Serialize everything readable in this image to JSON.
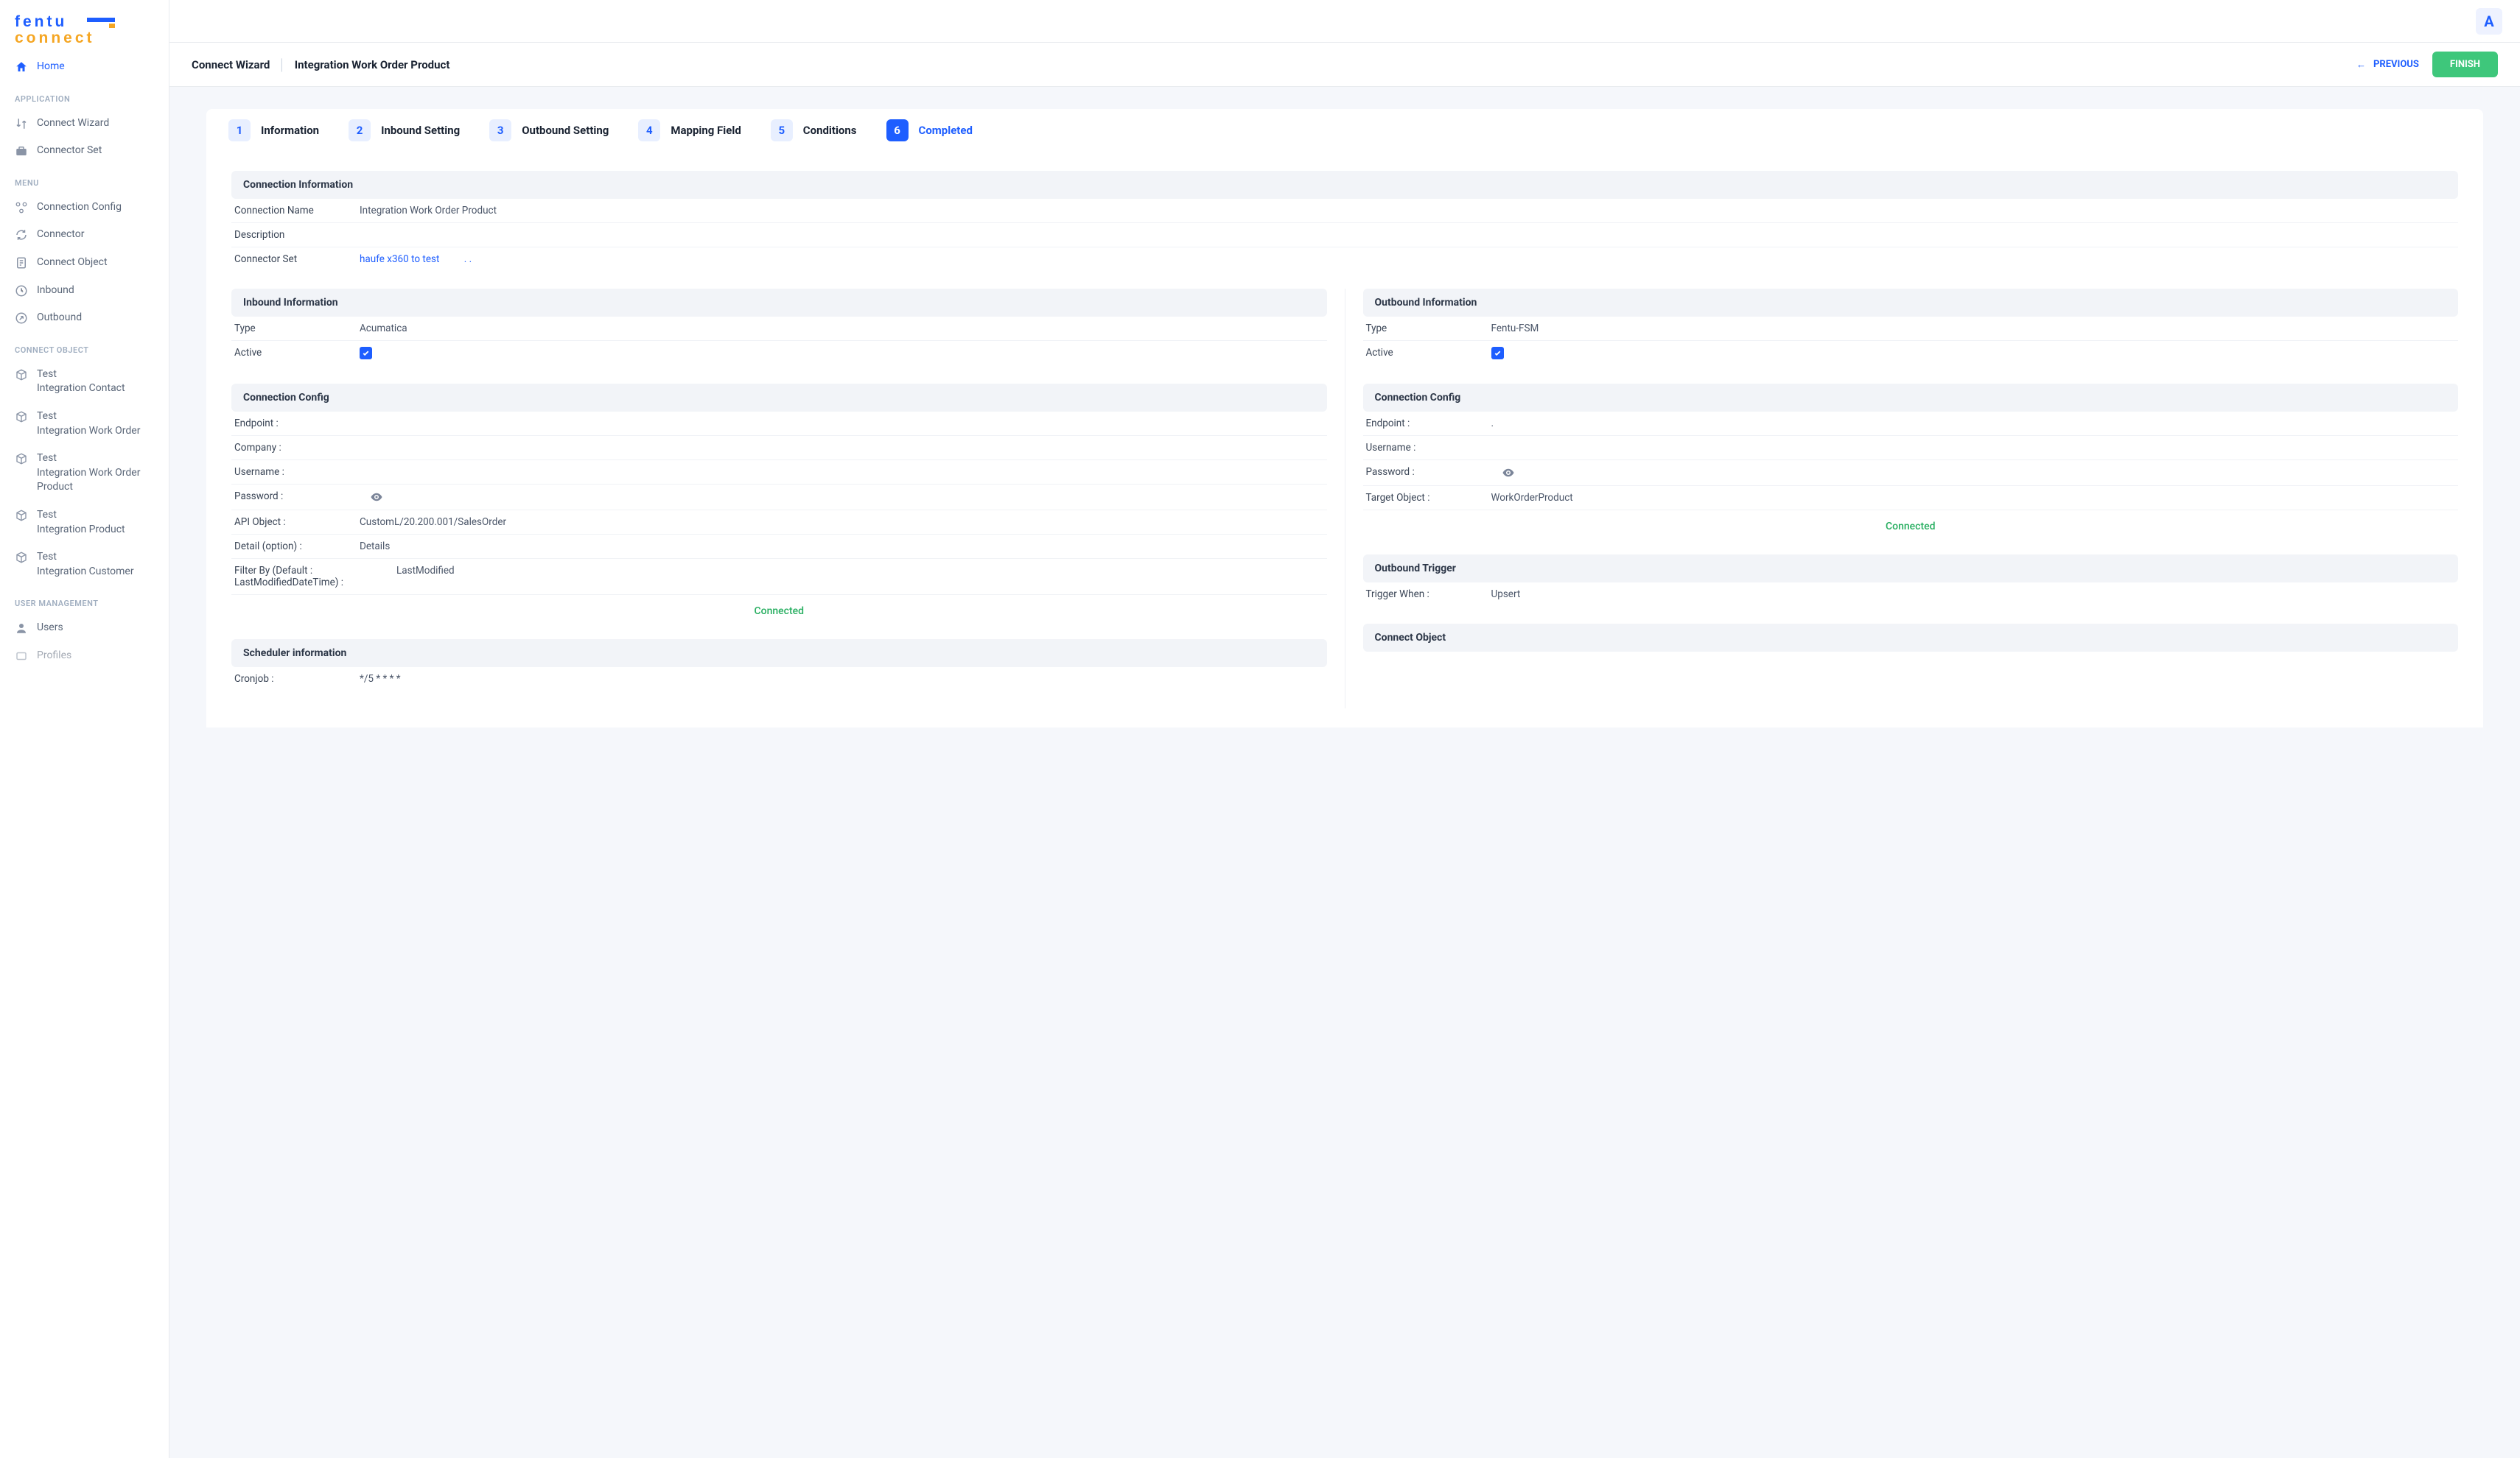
{
  "logo": {
    "line1a": "fentu",
    "line1b": "—",
    "line2": "connect"
  },
  "avatar_initial": "A",
  "sidebar": {
    "home": "Home",
    "sections": [
      {
        "heading": "APPLICATION",
        "items": [
          {
            "label": "Connect Wizard",
            "icon": "arrows"
          },
          {
            "label": "Connector Set",
            "icon": "briefcase"
          }
        ]
      },
      {
        "heading": "MENU",
        "items": [
          {
            "label": "Connection Config",
            "icon": "modules"
          },
          {
            "label": "Connector",
            "icon": "refresh"
          },
          {
            "label": "Connect Object",
            "icon": "doc"
          },
          {
            "label": "Inbound",
            "icon": "clock"
          },
          {
            "label": "Outbound",
            "icon": "outbound"
          }
        ]
      },
      {
        "heading": "CONNECT OBJECT",
        "items": [
          {
            "label": "Test\nIntegration Contact",
            "icon": "cube"
          },
          {
            "label": "Test\nIntegration Work Order",
            "icon": "cube"
          },
          {
            "label": "Test\nIntegration Work Order Product",
            "icon": "cube"
          },
          {
            "label": "Test\nIntegration Product",
            "icon": "cube"
          },
          {
            "label": "Test\nIntegration Customer",
            "icon": "cube"
          }
        ]
      },
      {
        "heading": "USER MANAGEMENT",
        "items": [
          {
            "label": "Users",
            "icon": "user"
          },
          {
            "label": "Profiles",
            "icon": "profiles"
          }
        ]
      }
    ]
  },
  "breadcrumb": {
    "a": "Connect Wizard",
    "b": "Integration Work Order Product"
  },
  "actions": {
    "previous": "PREVIOUS",
    "finish": "FINISH"
  },
  "steps": [
    {
      "n": "1",
      "label": "Information"
    },
    {
      "n": "2",
      "label": "Inbound Setting"
    },
    {
      "n": "3",
      "label": "Outbound Setting"
    },
    {
      "n": "4",
      "label": "Mapping Field"
    },
    {
      "n": "5",
      "label": "Conditions"
    },
    {
      "n": "6",
      "label": "Completed"
    }
  ],
  "conn_info": {
    "title": "Connection Information",
    "name_label": "Connection Name",
    "name_value": "Integration Work Order Product",
    "desc_label": "Description",
    "desc_value": "",
    "set_label": "Connector Set",
    "set_value": "haufe x360 to test",
    "set_extra": ". ."
  },
  "inbound": {
    "title": "Inbound Information",
    "type_label": "Type",
    "type_value": "Acumatica",
    "active_label": "Active",
    "config_title": "Connection Config",
    "endpoint_label": "Endpoint :",
    "endpoint_value": "",
    "company_label": "Company :",
    "company_value": "",
    "username_label": "Username :",
    "username_value": "",
    "password_label": "Password :",
    "api_object_label": "API Object :",
    "api_object_value": "CustomL/20.200.001/SalesOrder",
    "detail_label": "Detail (option) :",
    "detail_value": "Details",
    "filter_label": "Filter By (Default : LastModifiedDateTime) :",
    "filter_value": "LastModified",
    "connected": "Connected",
    "scheduler_title": "Scheduler information",
    "cron_label": "Cronjob :",
    "cron_value": "*/5 * * * *"
  },
  "outbound": {
    "title": "Outbound Information",
    "type_label": "Type",
    "type_value": "Fentu-FSM",
    "active_label": "Active",
    "config_title": "Connection Config",
    "endpoint_label": "Endpoint :",
    "endpoint_value": ".",
    "username_label": "Username :",
    "username_value": "",
    "password_label": "Password :",
    "target_label": "Target Object :",
    "target_value": "WorkOrderProduct",
    "connected": "Connected",
    "trigger_title": "Outbound Trigger",
    "trigger_label": "Trigger When :",
    "trigger_value": "Upsert",
    "connect_object_title": "Connect Object"
  }
}
